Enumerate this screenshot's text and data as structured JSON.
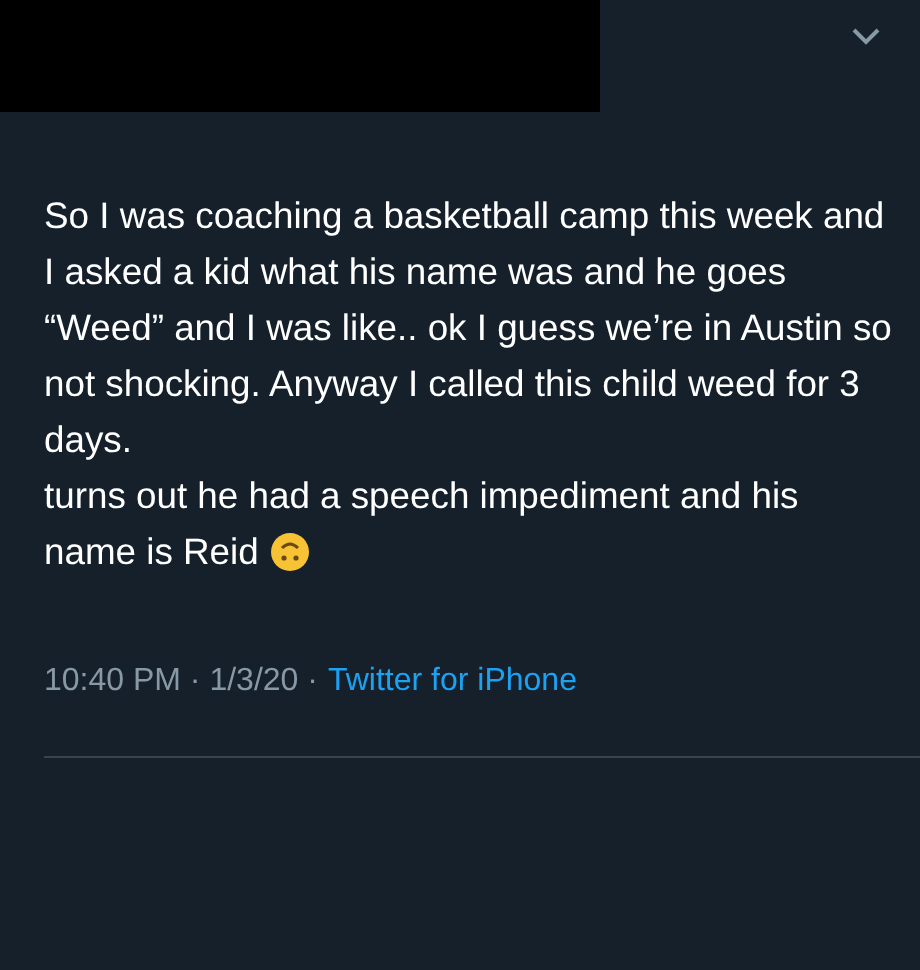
{
  "tweet": {
    "paragraphs": [
      "So I was coaching a basketball camp this week and I asked a kid what his name was and he goes “Weed” and I was like.. ok I guess we’re in Austin so not shocking. Anyway I called this child weed for 3 days.",
      "turns out he had a speech impediment and his name is Reid"
    ],
    "timestamp": "10:40 PM · 1/3/20 ·",
    "source": "Twitter for iPhone"
  }
}
